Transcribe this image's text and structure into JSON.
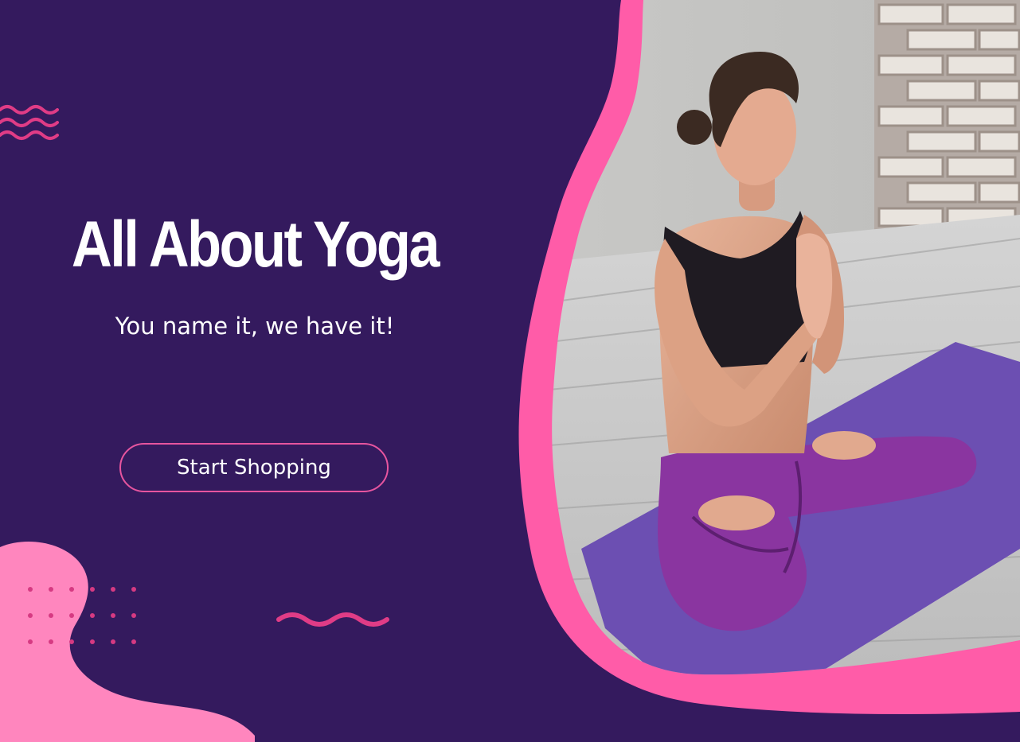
{
  "hero": {
    "headline": "All About Yoga",
    "tagline": "You name it, we have it!",
    "cta_label": "Start Shopping"
  },
  "colors": {
    "background": "#341a5e",
    "accent_pink": "#ff5ca8",
    "light_pink": "#ff86be",
    "dots_pink": "#d63a82",
    "wave_pink": "#e03c86",
    "mat_purple": "#6c4fb2",
    "leggings_purple": "#8a35a0"
  },
  "decorations": {
    "top_left": "wave-lines",
    "bottom_left": "pink-blob",
    "dot_grid": "dot-grid",
    "bottom_center": "squiggle"
  },
  "photo": {
    "subject": "yoga-meditation-photo"
  }
}
